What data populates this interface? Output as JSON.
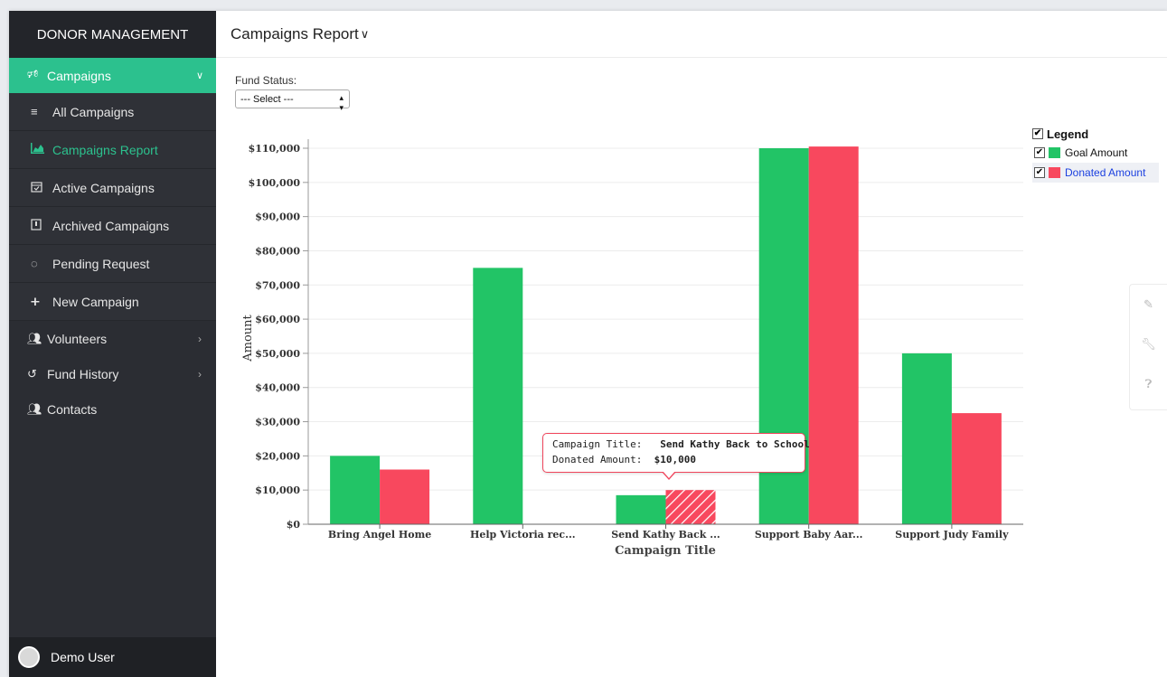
{
  "sidebar": {
    "brand": "DONOR MANAGEMENT",
    "group": {
      "label": "Campaigns"
    },
    "sub_items": [
      {
        "label": "All Campaigns"
      },
      {
        "label": "Campaigns Report"
      },
      {
        "label": "Active Campaigns"
      },
      {
        "label": "Archived Campaigns"
      },
      {
        "label": "Pending Request"
      },
      {
        "label": "New Campaign"
      }
    ],
    "items": [
      {
        "label": "Volunteers"
      },
      {
        "label": "Fund History"
      },
      {
        "label": "Contacts"
      }
    ],
    "user": "Demo User"
  },
  "header": {
    "title": "Campaigns Report"
  },
  "filter": {
    "label": "Fund Status:",
    "selected": "--- Select ---"
  },
  "legend": {
    "title": "Legend",
    "items": [
      {
        "label": "Goal Amount",
        "color": "#22c466"
      },
      {
        "label": "Donated Amount",
        "color": "#f8485e"
      }
    ]
  },
  "tooltip": {
    "title_label": "Campaign Title:",
    "title_value": "Send Kathy Back to School",
    "amount_label": "Donated Amount:",
    "amount_value": "$10,000"
  },
  "chart_data": {
    "type": "bar",
    "categories": [
      "Bring Angel Home",
      "Help Victoria rec...",
      "Send Kathy Back ...",
      "Support Baby Aar...",
      "Support Judy Family"
    ],
    "series": [
      {
        "name": "Goal Amount",
        "values": [
          20000,
          75000,
          8500,
          110000,
          50000
        ],
        "color": "#22c466"
      },
      {
        "name": "Donated Amount",
        "values": [
          16000,
          0,
          10000,
          110500,
          32500
        ],
        "color": "#f8485e"
      }
    ],
    "xlabel": "Campaign Title",
    "ylabel": "Amount",
    "ylim": [
      0,
      110000
    ],
    "yticks": [
      "$0",
      "$10,000",
      "$20,000",
      "$30,000",
      "$40,000",
      "$50,000",
      "$60,000",
      "$70,000",
      "$80,000",
      "$90,000",
      "$100,000",
      "$110,000"
    ],
    "highlighted": {
      "series": 1,
      "index": 2
    },
    "grid": true,
    "legend_position": "top-right"
  }
}
